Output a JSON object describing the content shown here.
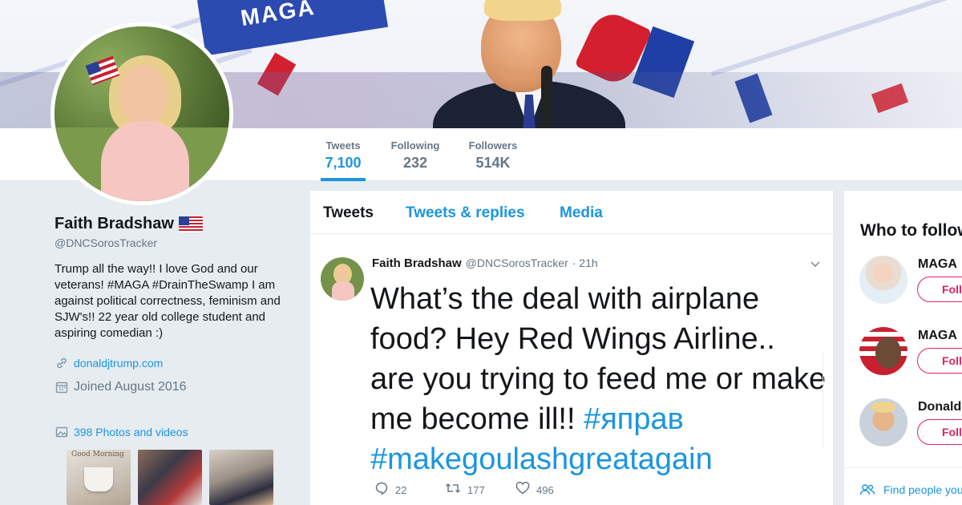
{
  "colors": {
    "accent": "#1b95e0",
    "follow": "#e0245e",
    "text": "#14171a",
    "muted": "#657786"
  },
  "banner": {
    "sign_text": "MAGA"
  },
  "nav": [
    {
      "label": "Tweets",
      "value": "7,100"
    },
    {
      "label": "Following",
      "value": "232"
    },
    {
      "label": "Followers",
      "value": "514K"
    }
  ],
  "profile": {
    "name": "Faith Bradshaw",
    "flag_icon": "us-flag-icon",
    "handle": "@DNCSorosTracker",
    "bio": "Trump all the way!! I love God and our veterans! #MAGA #DrainTheSwamp I am against political correctness, feminism and SJW's!! 22 year old college student and aspiring comedian :)",
    "link": "donaldjtrump.com",
    "joined": "Joined August 2016",
    "photos": "398 Photos and videos",
    "thumb1_caption": "Good Morning"
  },
  "tabs": [
    "Tweets",
    "Tweets & replies",
    "Media"
  ],
  "tweet": {
    "name": "Faith Bradshaw",
    "handle": "@DNCSorosTracker",
    "time": "· 21h",
    "text_plain": "What’s the deal with airplane food? Hey Red Wings Airline.. are you trying to feed me or make me become ill!! ",
    "hashtag1": "#яправ",
    "hashtag2": "#makegoulashgreatagain",
    "replies": "22",
    "retweets": "177",
    "likes": "496"
  },
  "who_to_follow": {
    "title": "Who to follow",
    "items": [
      {
        "name": "MAGA",
        "button": "Follow"
      },
      {
        "name": "MAGA",
        "button": "Follow"
      },
      {
        "name": "Donald",
        "button": "Follow"
      }
    ],
    "find": "Find people you know"
  }
}
